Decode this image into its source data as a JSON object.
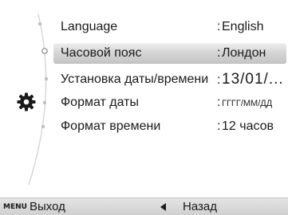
{
  "menu": {
    "items": [
      {
        "label": "Language",
        "value": "English"
      },
      {
        "label": "Часовой пояс",
        "value": "Лондон"
      },
      {
        "label": "Установка даты/времени",
        "value": "13/01/..."
      },
      {
        "label": "Формат даты",
        "value": "ГГГГ/ММ/ДД"
      },
      {
        "label": "Формат времени",
        "value": "12 часов"
      }
    ],
    "selected_index": 1,
    "separator": ":",
    "category_icon": "gear-icon"
  },
  "footer": {
    "menu_key": "MENU",
    "exit_label": "Выход",
    "back_label": "Назад",
    "back_icon": "left-arrow-icon"
  }
}
